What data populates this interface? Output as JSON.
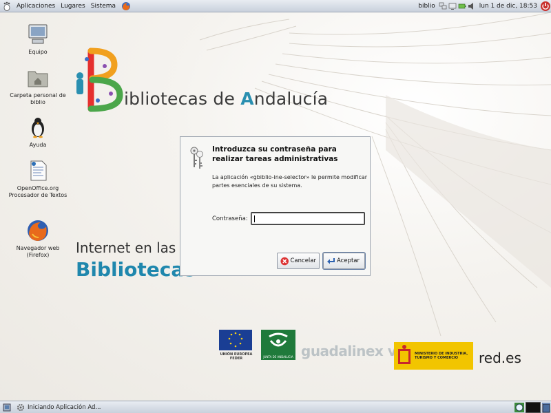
{
  "top_panel": {
    "menus": [
      "Aplicaciones",
      "Lugares",
      "Sistema"
    ],
    "user": "biblio",
    "clock": "lun  1 de dic, 18:53",
    "icons": [
      "foot-icon",
      "firefox-icon",
      "network-icon",
      "battery-icon",
      "power-icon"
    ]
  },
  "desktop_icons": [
    {
      "label": "Equipo",
      "icon": "computer-icon"
    },
    {
      "label": "Carpeta personal de biblio",
      "icon": "home-folder-icon"
    },
    {
      "label": "Ayuda",
      "icon": "help-penguin-icon"
    },
    {
      "label": "OpenOffice.org Procesador de Textos",
      "icon": "writer-icon"
    },
    {
      "label": "Navegador web (Firefox)",
      "icon": "firefox-icon"
    }
  ],
  "wallpaper": {
    "logo_text_1": "B",
    "logo_text_2": "ibliotecas",
    "logo_text_3": " de ",
    "logo_text_4": "A",
    "logo_text_5": "ndalucía",
    "internet_line1": "Internet en las",
    "internet_line2": "Bibliotecas",
    "sponsors": {
      "eu": "UNIÓN EUROPEA",
      "eu_sub": "FEDER",
      "junta": "JUNTA DE ANDALUCIA",
      "guadalinex": "guadalinex v5",
      "ministerio": "MINISTERIO DE INDUSTRIA, TURISMO Y COMERCIO",
      "redes": "red.es"
    }
  },
  "dialog": {
    "title": "Introduzca su contraseña para realizar tareas administrativas",
    "body": "La aplicación «gbiblio-ine-selector» le permite modificar partes esenciales de su sistema.",
    "password_label": "Contraseña:",
    "password_value": "",
    "cancel_label": "Cancelar",
    "accept_label": "Aceptar"
  },
  "bottom_panel": {
    "task_label": "Iniciando Aplicación Ad..."
  },
  "colors": {
    "accent_blue": "#2a8fb0",
    "panel_top": "#e8ecf2",
    "panel_bottom": "#c9d1dc"
  }
}
